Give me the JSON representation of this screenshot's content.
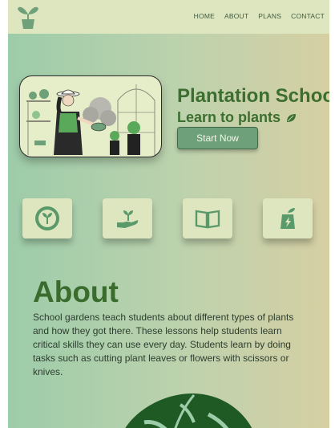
{
  "nav": {
    "logo_icon": "plant-pot-icon",
    "links": [
      "HOME",
      "ABOUT",
      "PLANS",
      "CONTACT"
    ]
  },
  "hero": {
    "title": "Plantation School",
    "subtitle": "Learn to plants",
    "subtitle_icon": "leaf-icon",
    "cta_label": "Start Now",
    "illustration": "gardener-with-plants-illustration"
  },
  "features": [
    {
      "icon": "seedling-badge-icon"
    },
    {
      "icon": "hand-with-sprout-icon"
    },
    {
      "icon": "open-book-icon"
    },
    {
      "icon": "eco-energy-icon"
    }
  ],
  "about": {
    "title": "About",
    "text": "School gardens teach students about different types of plants and how they got there. These lessons help students learn critical skills they can use every day. Students learn by doing tasks such as cutting plant leaves or flowers with scissors or knives."
  },
  "colors": {
    "accent": "#3c6e2f",
    "button": "#6ea07a",
    "nav_bg": "#dee6bf",
    "card_bg": "#dee6bf"
  }
}
